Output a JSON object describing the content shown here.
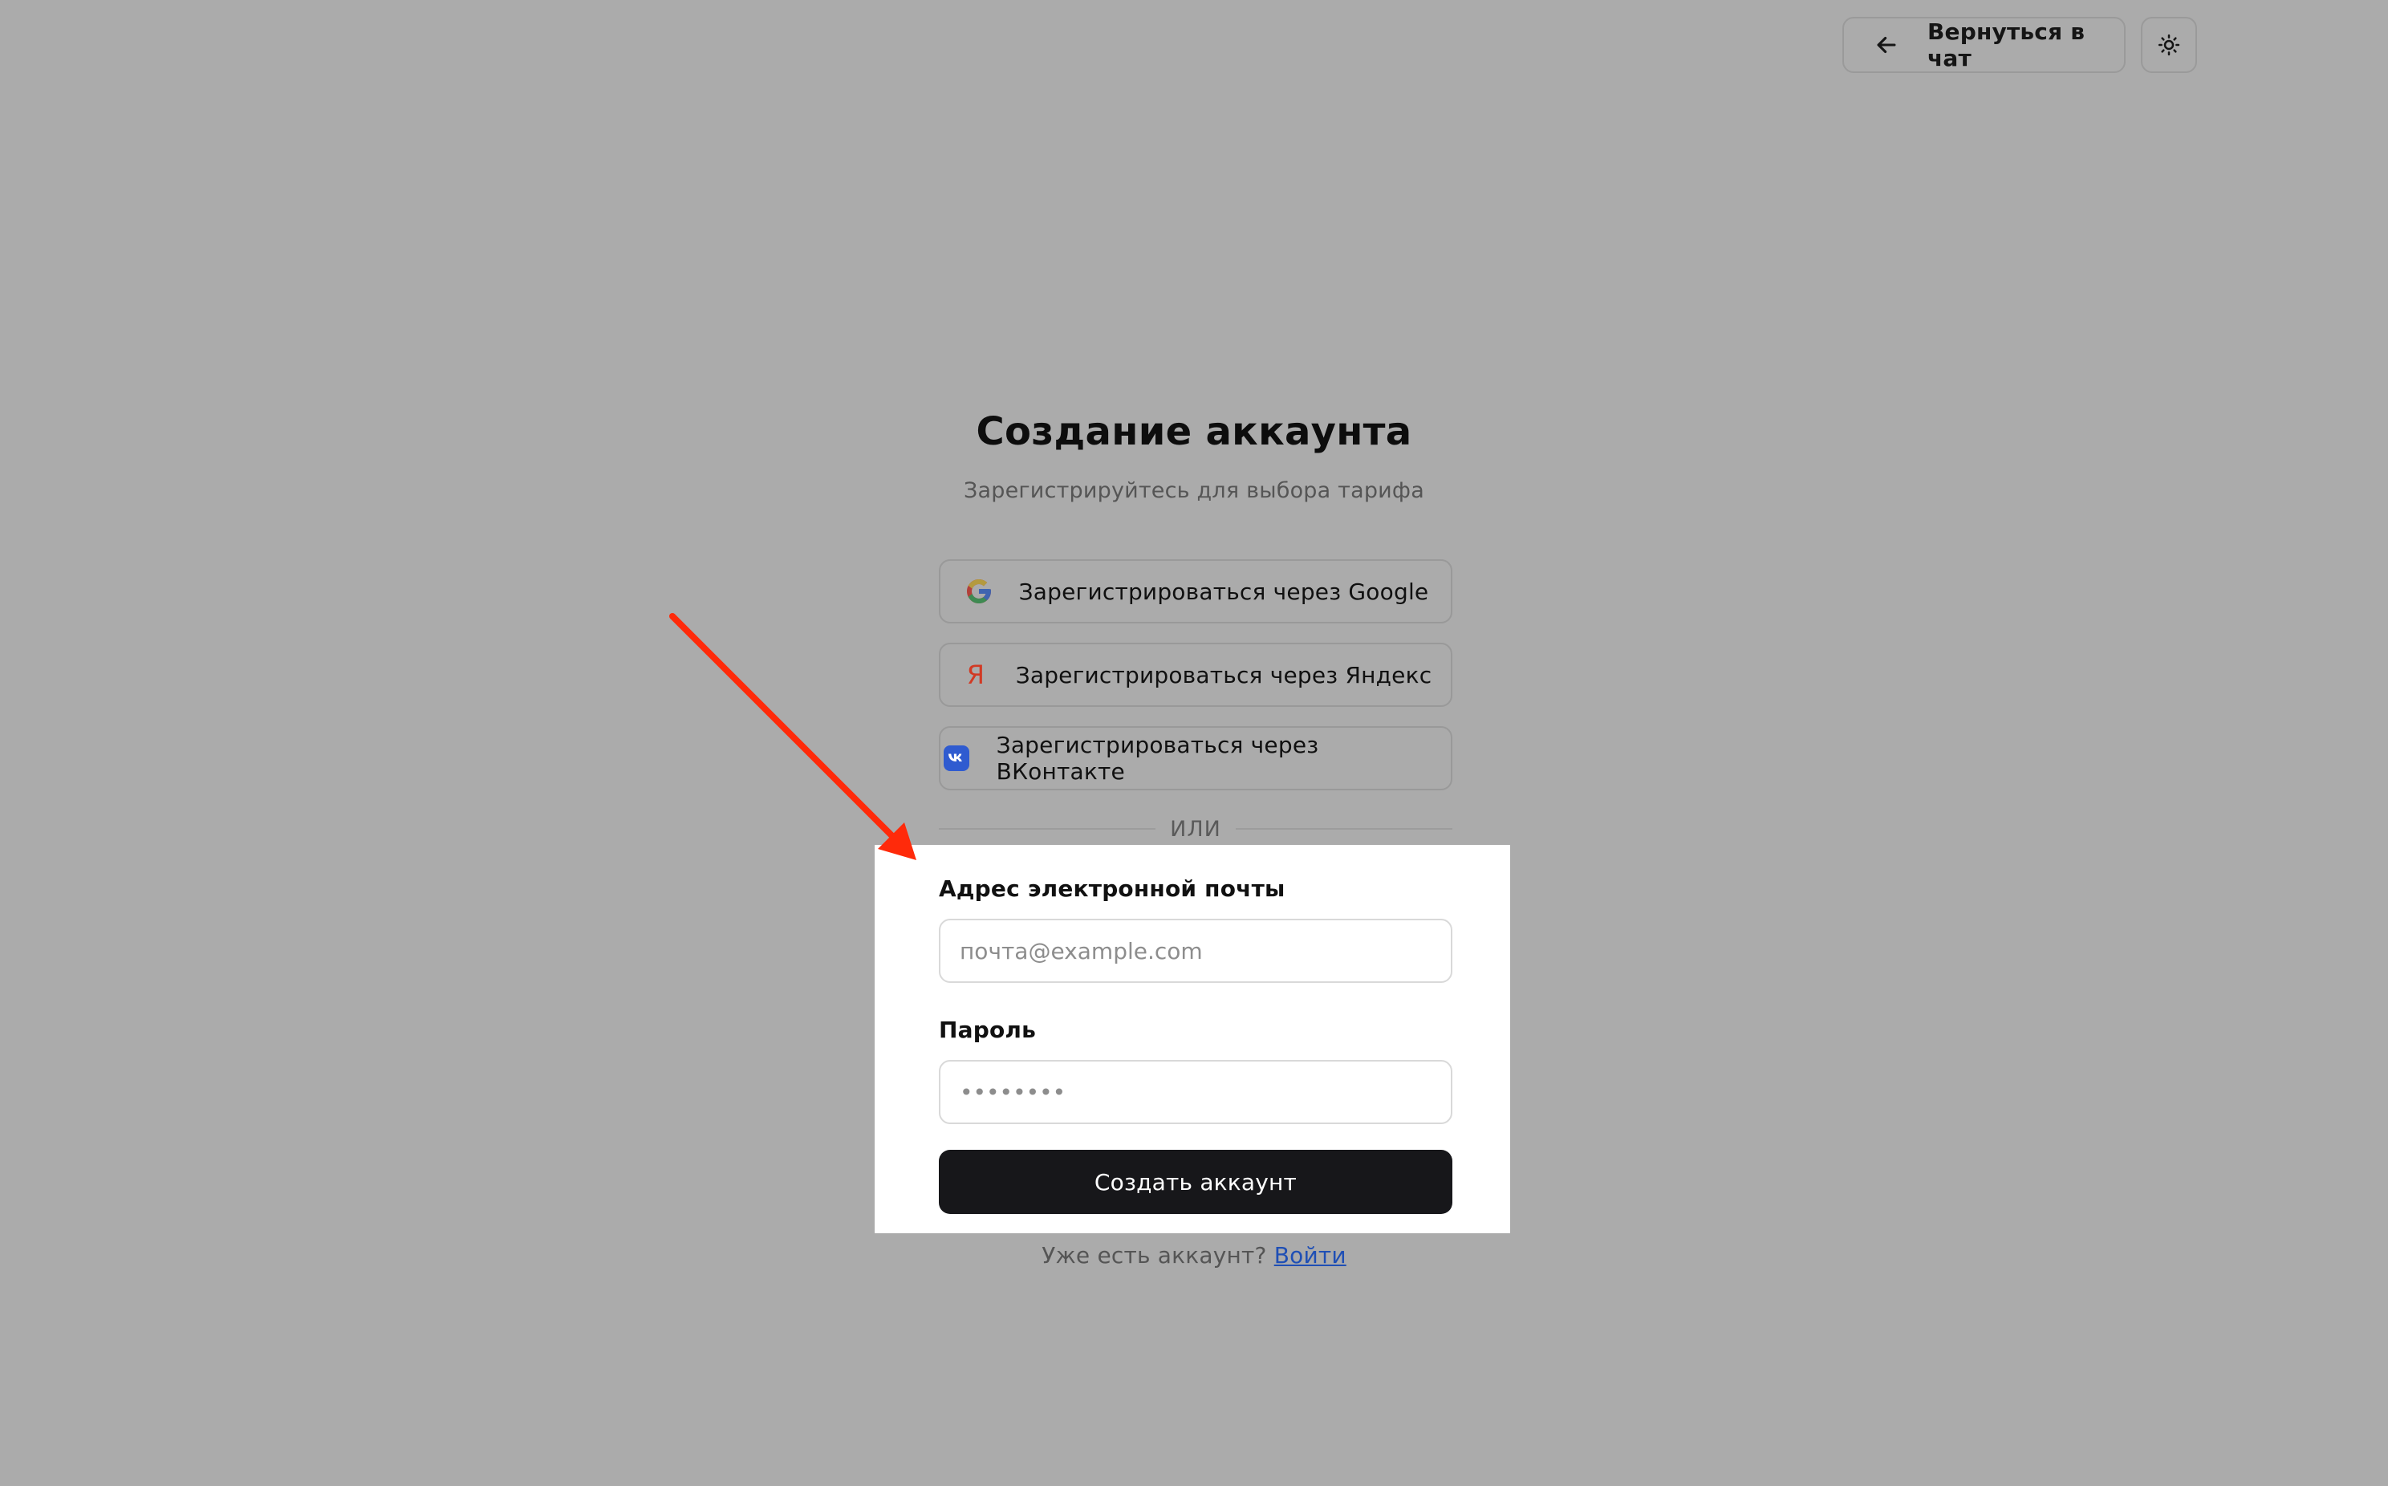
{
  "header": {
    "back_label": "Вернуться в чат",
    "back_icon": "arrow-left-icon",
    "theme_icon": "sun-icon"
  },
  "main": {
    "title": "Создание аккаунта",
    "subtitle": "Зарегистрируйтесь для выбора тарифа",
    "social": [
      {
        "label": "Зарегистрироваться через Google",
        "icon": "google-icon"
      },
      {
        "label": "Зарегистрироваться через Яндекс",
        "icon": "yandex-icon"
      },
      {
        "label": "Зарегистрироваться через ВКонтакте",
        "icon": "vk-icon"
      }
    ],
    "divider": "ИЛИ",
    "form": {
      "email_label": "Адрес электронной почты",
      "email_placeholder": "почта@example.com",
      "password_label": "Пароль",
      "password_placeholder": "••••••••",
      "submit_label": "Создать аккаунт"
    },
    "login_prompt": "Уже есть аккаунт?",
    "login_link": "Войти"
  },
  "colors": {
    "background": "#ababab",
    "highlight_panel": "#ffffff",
    "primary_button": "#17171a",
    "link": "#1f4fb5",
    "annotation_arrow": "#ff2a0a",
    "yandex": "#e33622",
    "vk": "#2f5bd0"
  }
}
